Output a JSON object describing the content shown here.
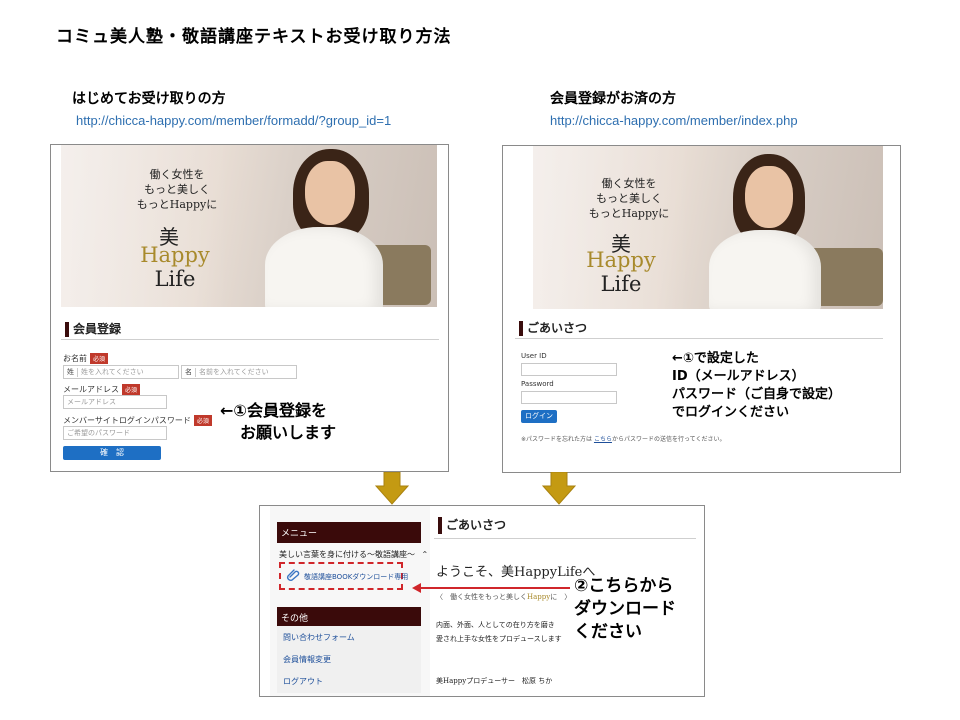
{
  "page": {
    "title": "コミュ美人塾・敬語講座テキストお受け取り方法",
    "left_heading": "はじめてお受け取りの方",
    "left_url": "http://chicca-happy.com/member/formadd/?group_id=1",
    "right_heading": "会員登録がお済の方",
    "right_url": "http://chicca-happy.com/member/index.php"
  },
  "hero": {
    "tagline_1": "働く女性を",
    "tagline_2": "もっと美しく",
    "tagline_3": "もっとHappyに",
    "logo_bi": "美",
    "logo_happy": "Happy",
    "logo_life": "Life"
  },
  "register_form": {
    "section_title": "会員登録",
    "name_label": "お名前",
    "required_badge": "必須",
    "last_name_prefix": "姓",
    "last_name_placeholder": "姓を入れてください",
    "first_name_prefix": "名",
    "first_name_placeholder": "名前を入れてください",
    "email_label": "メールアドレス",
    "email_placeholder": "メールアドレス",
    "password_label": "メンバーサイトログインパスワード",
    "password_placeholder": "ご希望のパスワード",
    "confirm_button": "確　認"
  },
  "login_form": {
    "section_title": "ごあいさつ",
    "user_id_label": "User ID",
    "password_label": "Password",
    "login_button": "ログイン",
    "forgot_note_prefix": "※パスワードを忘れた方は",
    "forgot_link": "こちら",
    "forgot_note_suffix": "からパスワードの送信を行ってください。"
  },
  "callouts": {
    "register_line1": "←①会員登録を",
    "register_line2": "お願いします",
    "login_line1": "←①で設定した",
    "login_line2": "ID（メールアドレス）",
    "login_line3": "パスワード（ご自身で設定）",
    "login_line4": "でログインください",
    "download_line1": "②こちらから",
    "download_line2": "ダウンロード",
    "download_line3": "ください"
  },
  "member_page": {
    "menu_heading": "メニュー",
    "course_item": "美しい言葉を身に付ける～敬語講座～",
    "download_link": "敬語講座BOOKダウンロード専用",
    "other_heading": "その他",
    "other_items": [
      "問い合わせフォーム",
      "会員情報変更",
      "ログアウト"
    ],
    "greeting_title": "ごあいさつ",
    "welcome": "ようこそ、美HappyLifeへ",
    "subtitle_pre": "〈　働く女性をもっと美しく",
    "subtitle_happy": "Happy",
    "subtitle_post": "に　〉",
    "body_line1": "内面、外面、人としての在り方を磨き",
    "body_line2": "愛され上手な女性をプロデュースします",
    "signature": "美Happyプロデューサー　松原 ちか"
  },
  "colors": {
    "link_blue": "#2e6fb0",
    "button_blue": "#1e6fc4",
    "required_red": "#c0392b",
    "arrow_gold": "#c49a12",
    "highlight_red": "#d0262b",
    "menu_dark": "#3a0a0a"
  },
  "icons": {
    "arrow_down": "down-arrow-icon",
    "paperclip": "paperclip-icon",
    "chevron_up": "chevron-up-icon"
  }
}
